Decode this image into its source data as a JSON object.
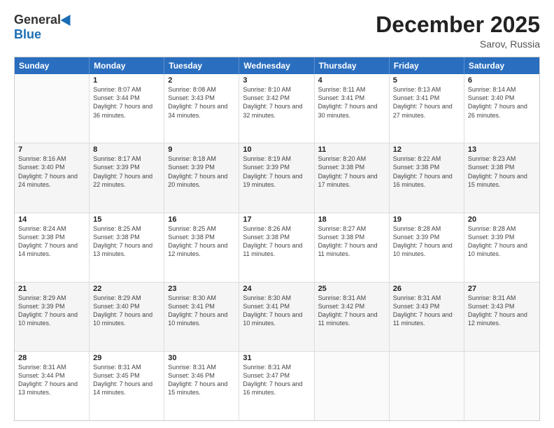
{
  "header": {
    "logo": {
      "general": "General",
      "blue": "Blue"
    },
    "title": "December 2025",
    "location": "Sarov, Russia"
  },
  "weekdays": [
    "Sunday",
    "Monday",
    "Tuesday",
    "Wednesday",
    "Thursday",
    "Friday",
    "Saturday"
  ],
  "rows": [
    {
      "alt": false,
      "cells": [
        {
          "day": "",
          "empty": true
        },
        {
          "day": "1",
          "sunrise": "Sunrise: 8:07 AM",
          "sunset": "Sunset: 3:44 PM",
          "daylight": "Daylight: 7 hours and 36 minutes."
        },
        {
          "day": "2",
          "sunrise": "Sunrise: 8:08 AM",
          "sunset": "Sunset: 3:43 PM",
          "daylight": "Daylight: 7 hours and 34 minutes."
        },
        {
          "day": "3",
          "sunrise": "Sunrise: 8:10 AM",
          "sunset": "Sunset: 3:42 PM",
          "daylight": "Daylight: 7 hours and 32 minutes."
        },
        {
          "day": "4",
          "sunrise": "Sunrise: 8:11 AM",
          "sunset": "Sunset: 3:41 PM",
          "daylight": "Daylight: 7 hours and 30 minutes."
        },
        {
          "day": "5",
          "sunrise": "Sunrise: 8:13 AM",
          "sunset": "Sunset: 3:41 PM",
          "daylight": "Daylight: 7 hours and 27 minutes."
        },
        {
          "day": "6",
          "sunrise": "Sunrise: 8:14 AM",
          "sunset": "Sunset: 3:40 PM",
          "daylight": "Daylight: 7 hours and 26 minutes."
        }
      ]
    },
    {
      "alt": true,
      "cells": [
        {
          "day": "7",
          "sunrise": "Sunrise: 8:16 AM",
          "sunset": "Sunset: 3:40 PM",
          "daylight": "Daylight: 7 hours and 24 minutes."
        },
        {
          "day": "8",
          "sunrise": "Sunrise: 8:17 AM",
          "sunset": "Sunset: 3:39 PM",
          "daylight": "Daylight: 7 hours and 22 minutes."
        },
        {
          "day": "9",
          "sunrise": "Sunrise: 8:18 AM",
          "sunset": "Sunset: 3:39 PM",
          "daylight": "Daylight: 7 hours and 20 minutes."
        },
        {
          "day": "10",
          "sunrise": "Sunrise: 8:19 AM",
          "sunset": "Sunset: 3:39 PM",
          "daylight": "Daylight: 7 hours and 19 minutes."
        },
        {
          "day": "11",
          "sunrise": "Sunrise: 8:20 AM",
          "sunset": "Sunset: 3:38 PM",
          "daylight": "Daylight: 7 hours and 17 minutes."
        },
        {
          "day": "12",
          "sunrise": "Sunrise: 8:22 AM",
          "sunset": "Sunset: 3:38 PM",
          "daylight": "Daylight: 7 hours and 16 minutes."
        },
        {
          "day": "13",
          "sunrise": "Sunrise: 8:23 AM",
          "sunset": "Sunset: 3:38 PM",
          "daylight": "Daylight: 7 hours and 15 minutes."
        }
      ]
    },
    {
      "alt": false,
      "cells": [
        {
          "day": "14",
          "sunrise": "Sunrise: 8:24 AM",
          "sunset": "Sunset: 3:38 PM",
          "daylight": "Daylight: 7 hours and 14 minutes."
        },
        {
          "day": "15",
          "sunrise": "Sunrise: 8:25 AM",
          "sunset": "Sunset: 3:38 PM",
          "daylight": "Daylight: 7 hours and 13 minutes."
        },
        {
          "day": "16",
          "sunrise": "Sunrise: 8:25 AM",
          "sunset": "Sunset: 3:38 PM",
          "daylight": "Daylight: 7 hours and 12 minutes."
        },
        {
          "day": "17",
          "sunrise": "Sunrise: 8:26 AM",
          "sunset": "Sunset: 3:38 PM",
          "daylight": "Daylight: 7 hours and 11 minutes."
        },
        {
          "day": "18",
          "sunrise": "Sunrise: 8:27 AM",
          "sunset": "Sunset: 3:38 PM",
          "daylight": "Daylight: 7 hours and 11 minutes."
        },
        {
          "day": "19",
          "sunrise": "Sunrise: 8:28 AM",
          "sunset": "Sunset: 3:39 PM",
          "daylight": "Daylight: 7 hours and 10 minutes."
        },
        {
          "day": "20",
          "sunrise": "Sunrise: 8:28 AM",
          "sunset": "Sunset: 3:39 PM",
          "daylight": "Daylight: 7 hours and 10 minutes."
        }
      ]
    },
    {
      "alt": true,
      "cells": [
        {
          "day": "21",
          "sunrise": "Sunrise: 8:29 AM",
          "sunset": "Sunset: 3:39 PM",
          "daylight": "Daylight: 7 hours and 10 minutes."
        },
        {
          "day": "22",
          "sunrise": "Sunrise: 8:29 AM",
          "sunset": "Sunset: 3:40 PM",
          "daylight": "Daylight: 7 hours and 10 minutes."
        },
        {
          "day": "23",
          "sunrise": "Sunrise: 8:30 AM",
          "sunset": "Sunset: 3:41 PM",
          "daylight": "Daylight: 7 hours and 10 minutes."
        },
        {
          "day": "24",
          "sunrise": "Sunrise: 8:30 AM",
          "sunset": "Sunset: 3:41 PM",
          "daylight": "Daylight: 7 hours and 10 minutes."
        },
        {
          "day": "25",
          "sunrise": "Sunrise: 8:31 AM",
          "sunset": "Sunset: 3:42 PM",
          "daylight": "Daylight: 7 hours and 11 minutes."
        },
        {
          "day": "26",
          "sunrise": "Sunrise: 8:31 AM",
          "sunset": "Sunset: 3:43 PM",
          "daylight": "Daylight: 7 hours and 11 minutes."
        },
        {
          "day": "27",
          "sunrise": "Sunrise: 8:31 AM",
          "sunset": "Sunset: 3:43 PM",
          "daylight": "Daylight: 7 hours and 12 minutes."
        }
      ]
    },
    {
      "alt": false,
      "cells": [
        {
          "day": "28",
          "sunrise": "Sunrise: 8:31 AM",
          "sunset": "Sunset: 3:44 PM",
          "daylight": "Daylight: 7 hours and 13 minutes."
        },
        {
          "day": "29",
          "sunrise": "Sunrise: 8:31 AM",
          "sunset": "Sunset: 3:45 PM",
          "daylight": "Daylight: 7 hours and 14 minutes."
        },
        {
          "day": "30",
          "sunrise": "Sunrise: 8:31 AM",
          "sunset": "Sunset: 3:46 PM",
          "daylight": "Daylight: 7 hours and 15 minutes."
        },
        {
          "day": "31",
          "sunrise": "Sunrise: 8:31 AM",
          "sunset": "Sunset: 3:47 PM",
          "daylight": "Daylight: 7 hours and 16 minutes."
        },
        {
          "day": "",
          "empty": true
        },
        {
          "day": "",
          "empty": true
        },
        {
          "day": "",
          "empty": true
        }
      ]
    }
  ]
}
